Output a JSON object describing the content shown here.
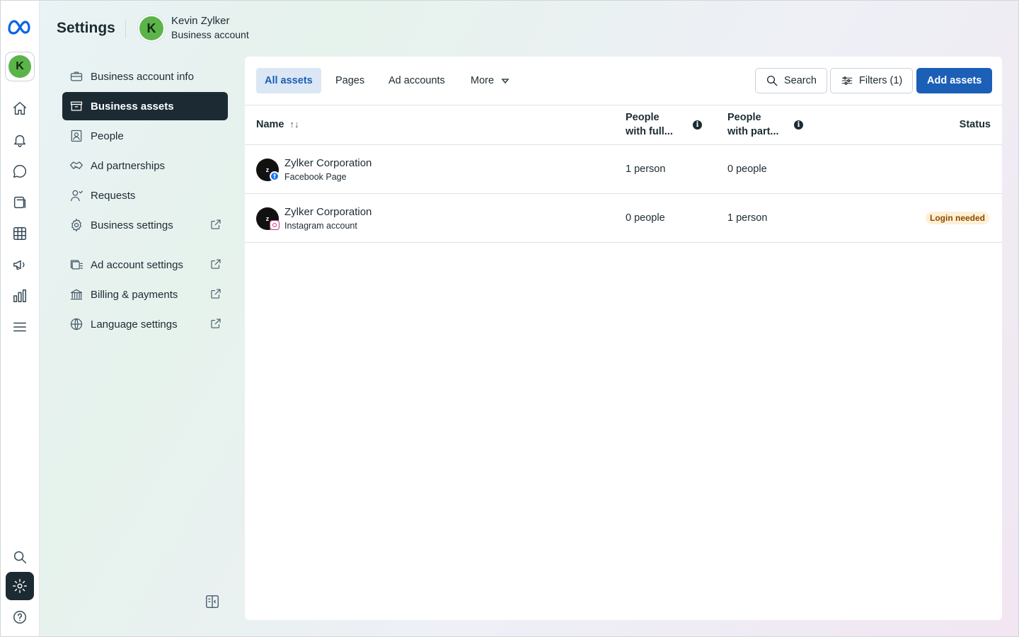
{
  "header": {
    "title": "Settings",
    "account_initial": "K",
    "account_name": "Kevin Zylker",
    "account_type": "Business account"
  },
  "rail": {
    "avatar_initial": "K",
    "items": [
      "home-icon",
      "notifications-icon",
      "messages-icon",
      "pages-icon",
      "table-icon",
      "ads-icon",
      "insights-icon",
      "menu-icon",
      "search-icon",
      "settings-icon",
      "help-icon"
    ]
  },
  "nav": {
    "items": [
      {
        "label": "Business account info",
        "icon": "briefcase-icon"
      },
      {
        "label": "Business assets",
        "icon": "assets-icon",
        "active": true
      },
      {
        "label": "People",
        "icon": "people-icon"
      },
      {
        "label": "Ad partnerships",
        "icon": "handshake-icon"
      },
      {
        "label": "Requests",
        "icon": "requests-icon"
      },
      {
        "label": "Business settings",
        "icon": "gear-icon",
        "external": true
      },
      {
        "label": "Ad account settings",
        "icon": "ad-account-icon",
        "external": true
      },
      {
        "label": "Billing & payments",
        "icon": "bank-icon",
        "external": true
      },
      {
        "label": "Language settings",
        "icon": "globe-icon",
        "external": true
      }
    ]
  },
  "tabs": [
    {
      "label": "All assets",
      "active": true
    },
    {
      "label": "Pages"
    },
    {
      "label": "Ad accounts"
    },
    {
      "label": "More"
    }
  ],
  "toolbar": {
    "search_label": "Search",
    "filters_label": "Filters (1)",
    "add_label": "Add assets"
  },
  "table": {
    "columns": [
      "Name",
      "People with full...",
      "People with part...",
      "Status"
    ],
    "col_full_line1": "People",
    "col_full_line2": "with full...",
    "col_part_line1": "People",
    "col_part_line2": "with part...",
    "rows": [
      {
        "name": "Zylker Corporation",
        "type": "Facebook Page",
        "full": "1 person",
        "partial": "0 people",
        "status": "",
        "avatar_text": "z",
        "badge": "facebook"
      },
      {
        "name": "Zylker Corporation",
        "type": "Instagram account",
        "full": "0 people",
        "partial": "1 person",
        "status": "Login needed",
        "avatar_text": "z",
        "badge": "instagram"
      }
    ]
  },
  "colors": {
    "accent": "#1b5fb7",
    "dark": "#1c2b33",
    "avatar_green": "#5bb44a",
    "status_bg": "#fdf0d5",
    "status_text": "#8a4a00"
  }
}
